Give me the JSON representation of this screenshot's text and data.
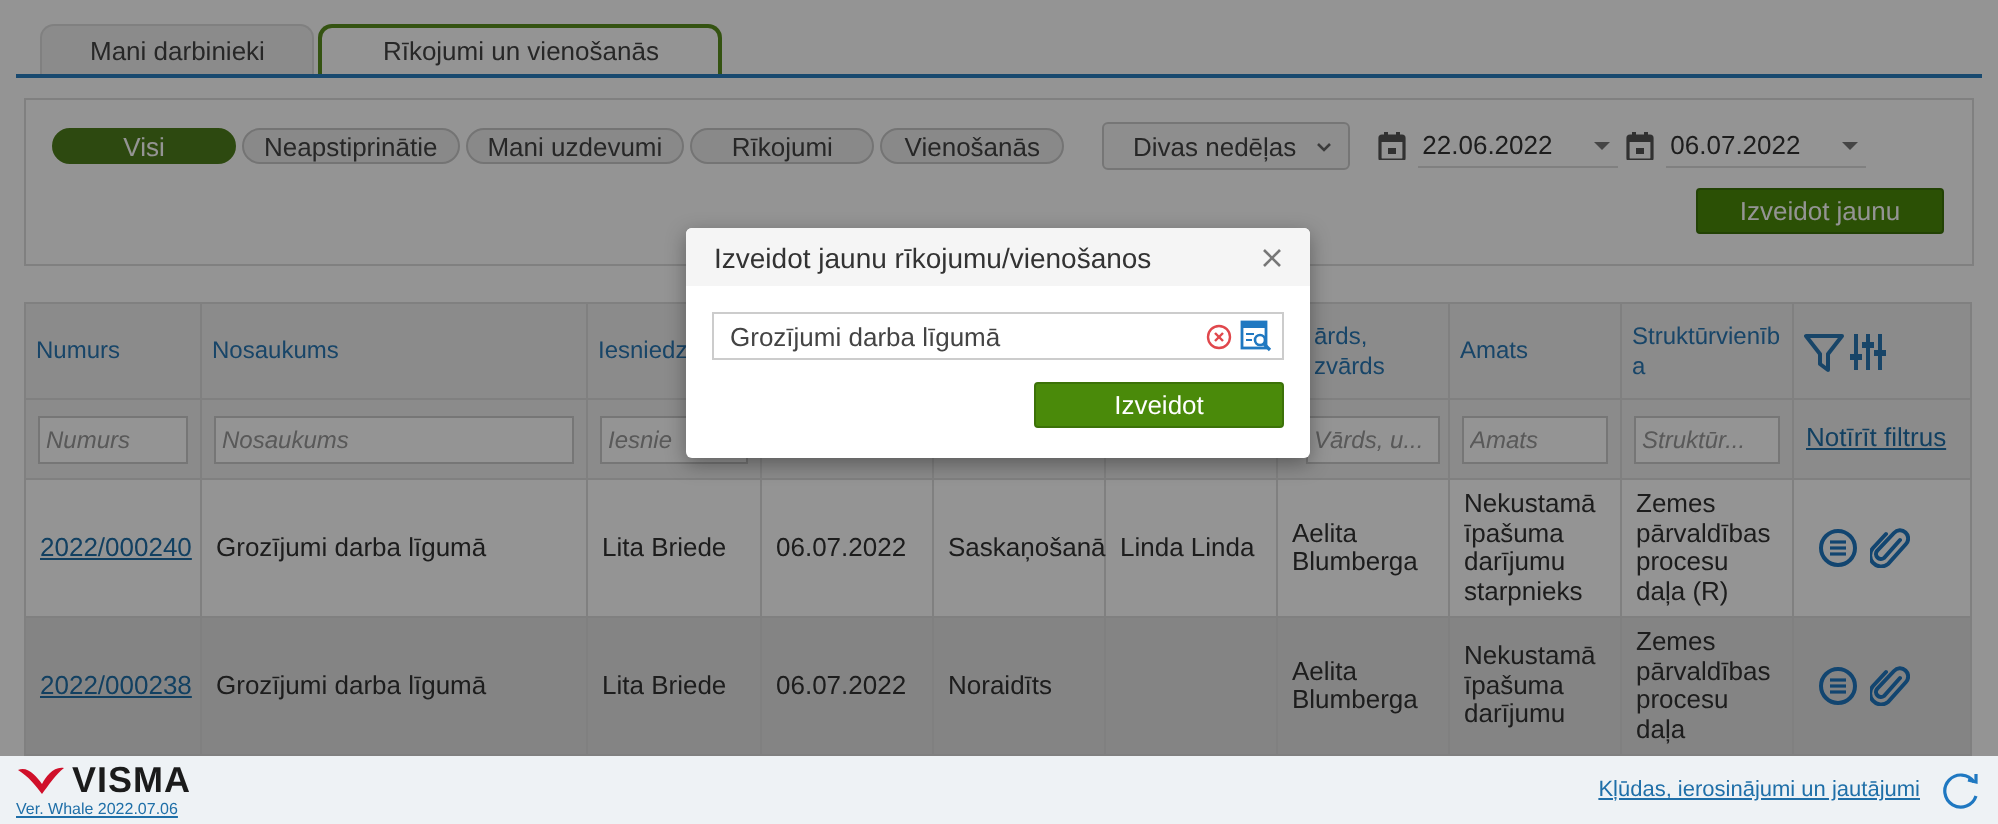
{
  "tabs": [
    {
      "label": "Mani darbinieki",
      "selected": false
    },
    {
      "label": "Rīkojumi un vienošanās",
      "selected": true
    }
  ],
  "filters": [
    {
      "label": "Visi",
      "selected": true
    },
    {
      "label": "Neapstiprinātie",
      "selected": false
    },
    {
      "label": "Mani uzdevumi",
      "selected": false
    },
    {
      "label": "Rīkojumi",
      "selected": false
    },
    {
      "label": "Vienošanās",
      "selected": false
    }
  ],
  "period": {
    "value": "Divas nedēļas"
  },
  "date_from": {
    "value": "22.06.2022"
  },
  "date_to": {
    "value": "06.07.2022"
  },
  "create_button": "Izveidot jaunu",
  "table": {
    "columns": [
      {
        "label": "Numurs",
        "placeholder": "Numurs"
      },
      {
        "label": "Nosaukums",
        "placeholder": "Nosaukums"
      },
      {
        "label": "Iesniedz",
        "placeholder": "Iesnie"
      },
      {},
      {},
      {},
      {
        "label": "ārds, zvārds",
        "placeholder": "Vārds, u..."
      },
      {
        "label": "Amats",
        "placeholder": "Amats"
      },
      {
        "label": "Struktūrvienība",
        "placeholder": "Struktūr..."
      }
    ],
    "clear_filters": "Notīrīt filtrus",
    "rows": [
      {
        "hovered": false,
        "cells": [
          "2022/000240",
          "Grozījumi darba līgumā",
          "Lita Briede",
          "06.07.2022",
          "Saskaņošanā",
          "Linda Linda",
          "Aelita Blumberga",
          "Nekustamā īpašuma darījumu starpnieks",
          "Zemes pārvaldības procesu daļa (R)"
        ]
      },
      {
        "hovered": true,
        "cells": [
          "2022/000238",
          "Grozījumi darba līgumā",
          "Lita Briede",
          "06.07.2022",
          "Noraidīts",
          null,
          "Aelita Blumberga",
          "Nekustamā īpašuma darījumu",
          "Zemes pārvaldības procesu daļa"
        ]
      }
    ]
  },
  "dialog": {
    "title": "Izveidot jaunu rīkojumu/vienošanos",
    "value": "Grozījumi darba līgumā",
    "button": "Izveidot"
  },
  "footer": {
    "logo": "VISMA",
    "version": "Ver. Whale 2022.07.06",
    "feedback_link": "Kļūdas, ierosinājumi un jautājumi"
  }
}
